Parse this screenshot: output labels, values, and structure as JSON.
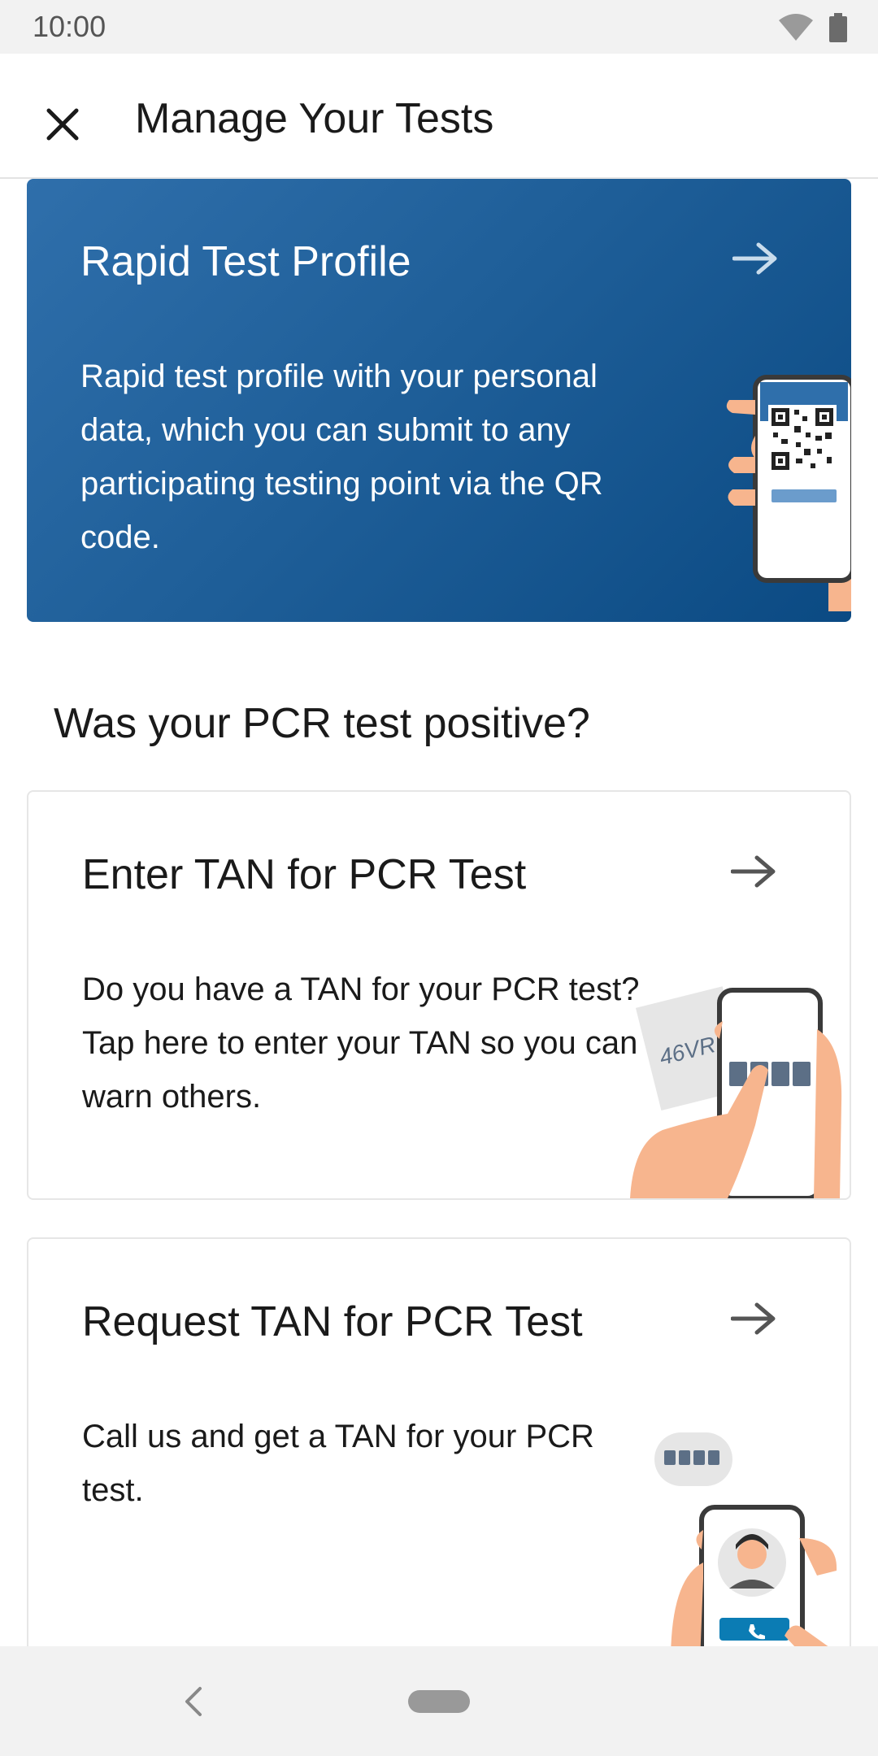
{
  "status": {
    "time": "10:00",
    "icons": [
      "wifi-icon",
      "battery-icon"
    ]
  },
  "app_bar": {
    "title": "Manage Your Tests",
    "close_icon": "close-icon"
  },
  "hero": {
    "title": "Rapid Test Profile",
    "body": "Rapid test profile with your personal data, which you can submit to any participating testing point via the QR code.",
    "arrow_icon": "arrow-right-icon",
    "gradient": [
      "#2f6fab",
      "#0b4a83"
    ]
  },
  "section": {
    "heading": "Was your PCR test positive?"
  },
  "cards": [
    {
      "title": "Enter TAN for PCR Test",
      "body": "Do you have a TAN for your PCR test? Tap here to enter your TAN so you can warn others.",
      "illustration_text": "46VR1E8"
    },
    {
      "title": "Request TAN for PCR Test",
      "body": "Call us and get a TAN for your PCR test."
    }
  ],
  "colors": {
    "accent_blue": "#1f5f99",
    "skin": "#f7b58e",
    "phone_frame": "#444444",
    "slate": "#5c6f86",
    "call_button": "#0b7cb4"
  },
  "nav": {
    "icons": [
      "back-icon",
      "home-pill"
    ]
  }
}
